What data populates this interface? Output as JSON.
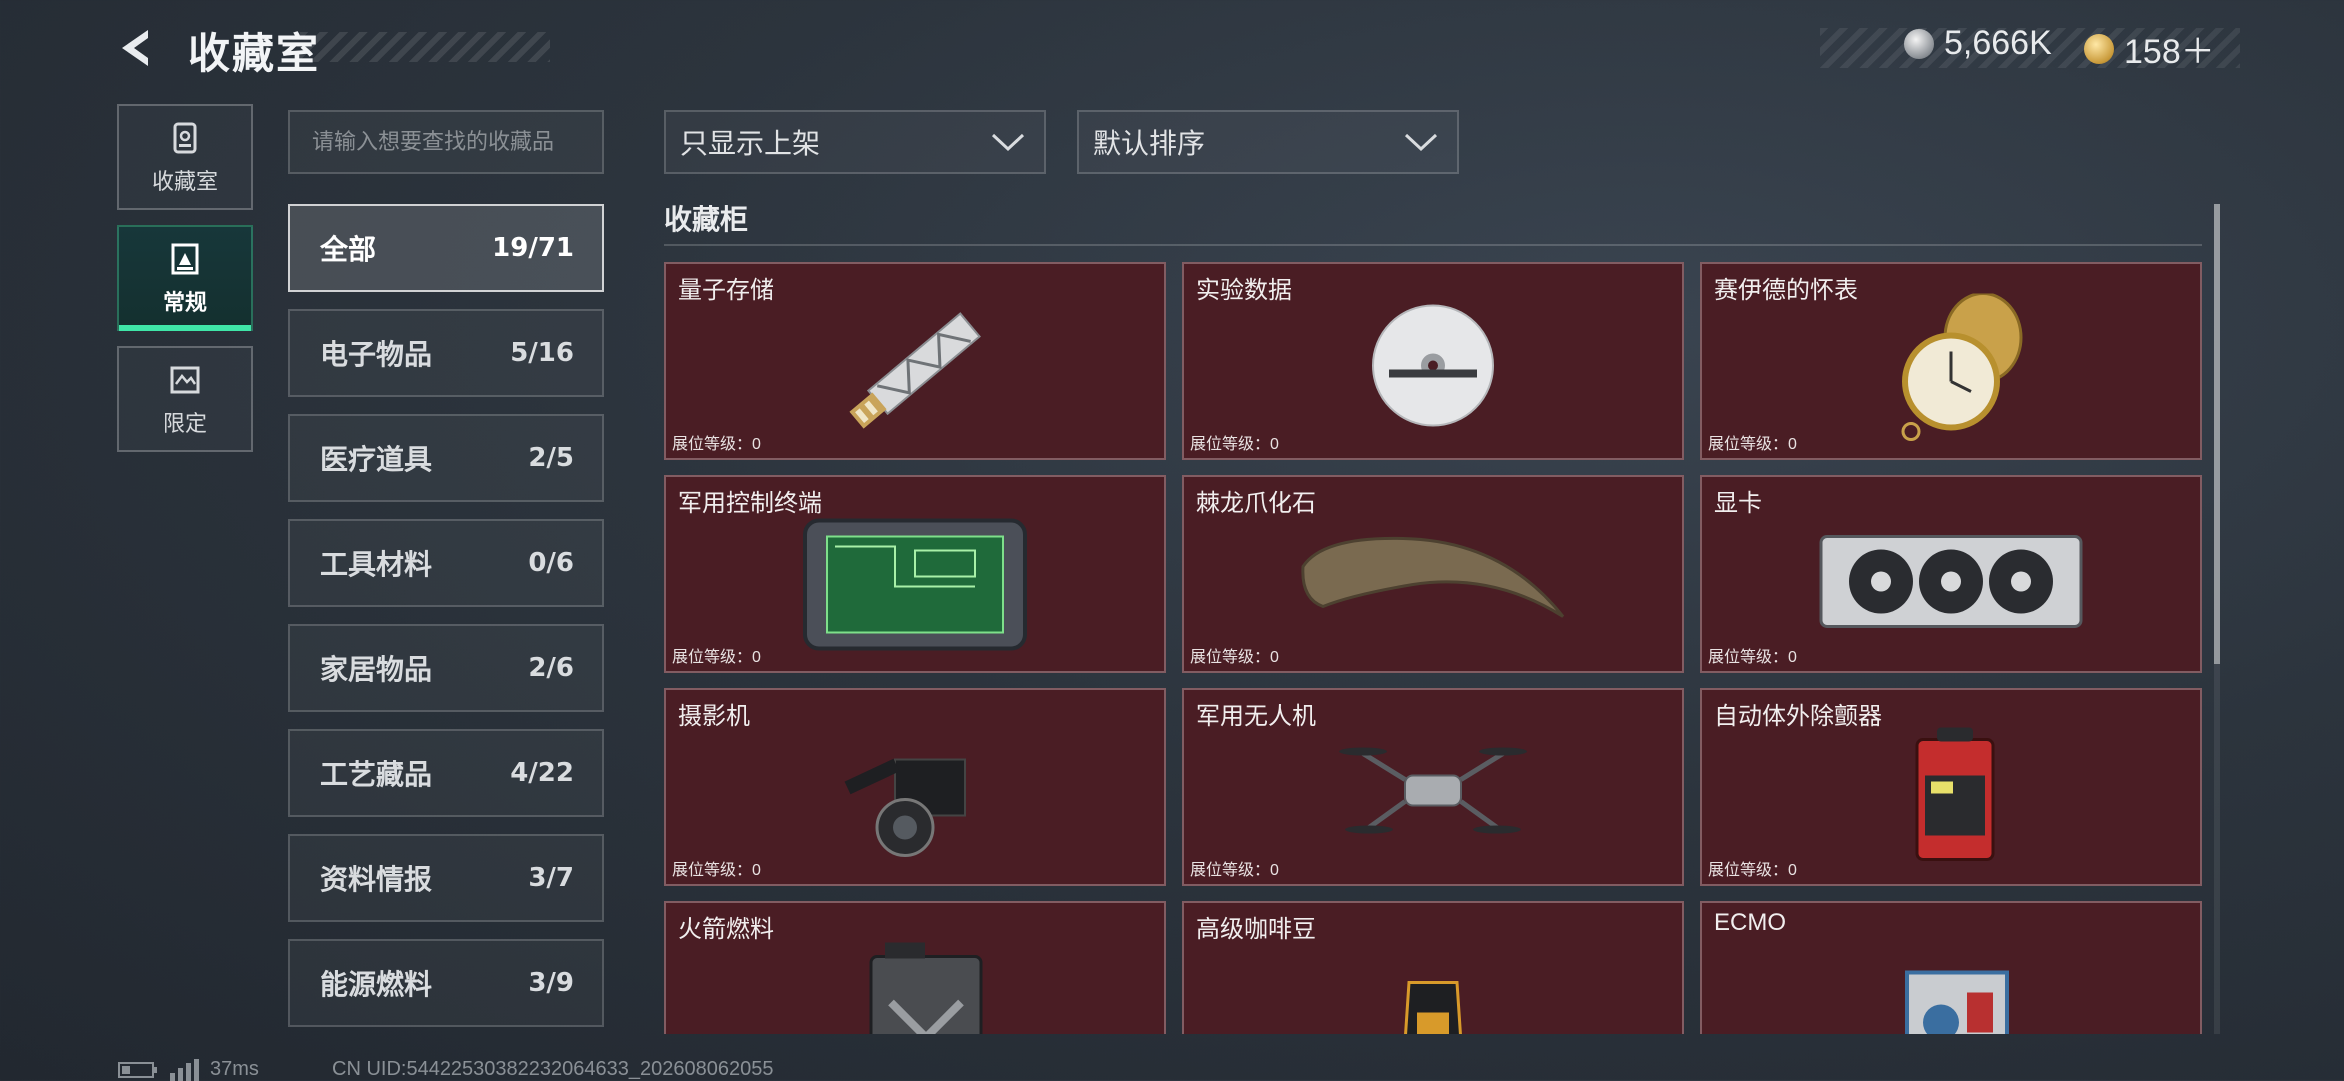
{
  "header": {
    "title": "收藏室",
    "currency": [
      {
        "icon": "silver-coin-icon",
        "value": "5,666K"
      },
      {
        "icon": "gold-coin-icon",
        "value": "158＋"
      }
    ]
  },
  "nav": [
    {
      "label": "收藏室",
      "icon": "collection-room-icon",
      "active": false
    },
    {
      "label": "常规",
      "icon": "regular-icon",
      "active": true
    },
    {
      "label": "限定",
      "icon": "limited-icon",
      "active": false
    }
  ],
  "search": {
    "placeholder": "请输入想要查找的收藏品"
  },
  "categories": [
    {
      "name": "全部",
      "count": "19/71",
      "active": true
    },
    {
      "name": "电子物品",
      "count": "5/16",
      "active": false
    },
    {
      "name": "医疗道具",
      "count": "2/5",
      "active": false
    },
    {
      "name": "工具材料",
      "count": "0/6",
      "active": false
    },
    {
      "name": "家居物品",
      "count": "2/6",
      "active": false
    },
    {
      "name": "工艺藏品",
      "count": "4/22",
      "active": false
    },
    {
      "name": "资料情报",
      "count": "3/7",
      "active": false
    },
    {
      "name": "能源燃料",
      "count": "3/9",
      "active": false
    }
  ],
  "filters": {
    "display": "只显示上架",
    "sort": "默认排序"
  },
  "section_title": "收藏柜",
  "items": [
    {
      "name": "量子存储",
      "level": "展位等级：0",
      "icon": "usb-drive-icon"
    },
    {
      "name": "实验数据",
      "level": "展位等级：0",
      "icon": "disc-icon"
    },
    {
      "name": "赛伊德的怀表",
      "level": "展位等级：0",
      "icon": "pocket-watch-icon"
    },
    {
      "name": "军用控制终端",
      "level": "展位等级：0",
      "icon": "control-terminal-icon"
    },
    {
      "name": "棘龙爪化石",
      "level": "展位等级：0",
      "icon": "claw-fossil-icon"
    },
    {
      "name": "显卡",
      "level": "展位等级：0",
      "icon": "graphics-card-icon"
    },
    {
      "name": "摄影机",
      "level": "展位等级：0",
      "icon": "video-camera-icon"
    },
    {
      "name": "军用无人机",
      "level": "展位等级：0",
      "icon": "drone-icon"
    },
    {
      "name": "自动体外除颤器",
      "level": "展位等级：0",
      "icon": "defibrillator-icon"
    },
    {
      "name": "火箭燃料",
      "level": "",
      "icon": "fuel-can-icon"
    },
    {
      "name": "高级咖啡豆",
      "level": "",
      "icon": "coffee-bag-icon"
    },
    {
      "name": "ECMO",
      "level": "",
      "icon": "ecmo-icon"
    }
  ],
  "status_bar": {
    "ping": "37ms",
    "uid": "CN UID:5442253038223206463​3_202608062055"
  },
  "colors": {
    "accent": "#3fe6a8",
    "card_bg": "#4a1d24",
    "background": "#2c343d"
  }
}
